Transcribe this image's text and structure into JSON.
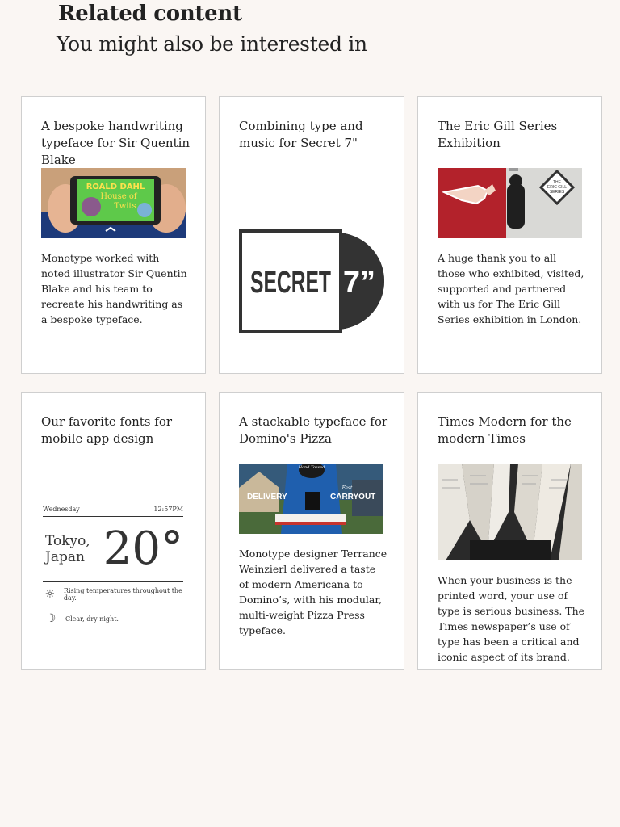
{
  "section": {
    "label": "Related content",
    "heading": "You might also be interested in"
  },
  "cards": [
    {
      "title": "A bespoke handwriting typeface for Sir Quentin Blake",
      "description": "Monotype worked with noted illustrator Sir Quentin Blake and his team to recreate his handwriting as a bespoke typeface.",
      "image_text": [
        "ROALD DAHL",
        "House of",
        "Twits"
      ]
    },
    {
      "title": "Combining type and music for Secret 7\"",
      "description": "",
      "logo_text": [
        "SECRET",
        "7”"
      ]
    },
    {
      "title": "The Eric Gill Series Exhibition",
      "description": "A huge thank you to all those who exhibited, visited, supported and partnered with us for The Eric Gill Series exhibition in London.",
      "image_text": [
        "THE",
        "ERIC GILL",
        "SERIES"
      ]
    },
    {
      "title": "Our favorite fonts for mobile app design",
      "description": "",
      "weather": {
        "day": "Wednesday",
        "time": "12:57PM",
        "city_line1": "Tokyo,",
        "city_line2": "Japan",
        "temp": "20°",
        "row1": "Rising temperatures throughout the day.",
        "row2": "Clear, dry night."
      }
    },
    {
      "title": "A stackable typeface for Domino's Pizza",
      "description": "Monotype designer Terrance Weinzierl delivered a taste of modern Americana to Domino’s, with his modular, multi-weight Pizza Press typeface.",
      "image_text": [
        "DELIVERY",
        "CARRYOUT",
        "Hand Tossed",
        "Fast"
      ]
    },
    {
      "title": "Times Modern for the modern Times",
      "description": "When your business is the printed word, your use of type is serious business. The Times newspaper’s use of type has been a critical and iconic aspect of its brand."
    }
  ]
}
